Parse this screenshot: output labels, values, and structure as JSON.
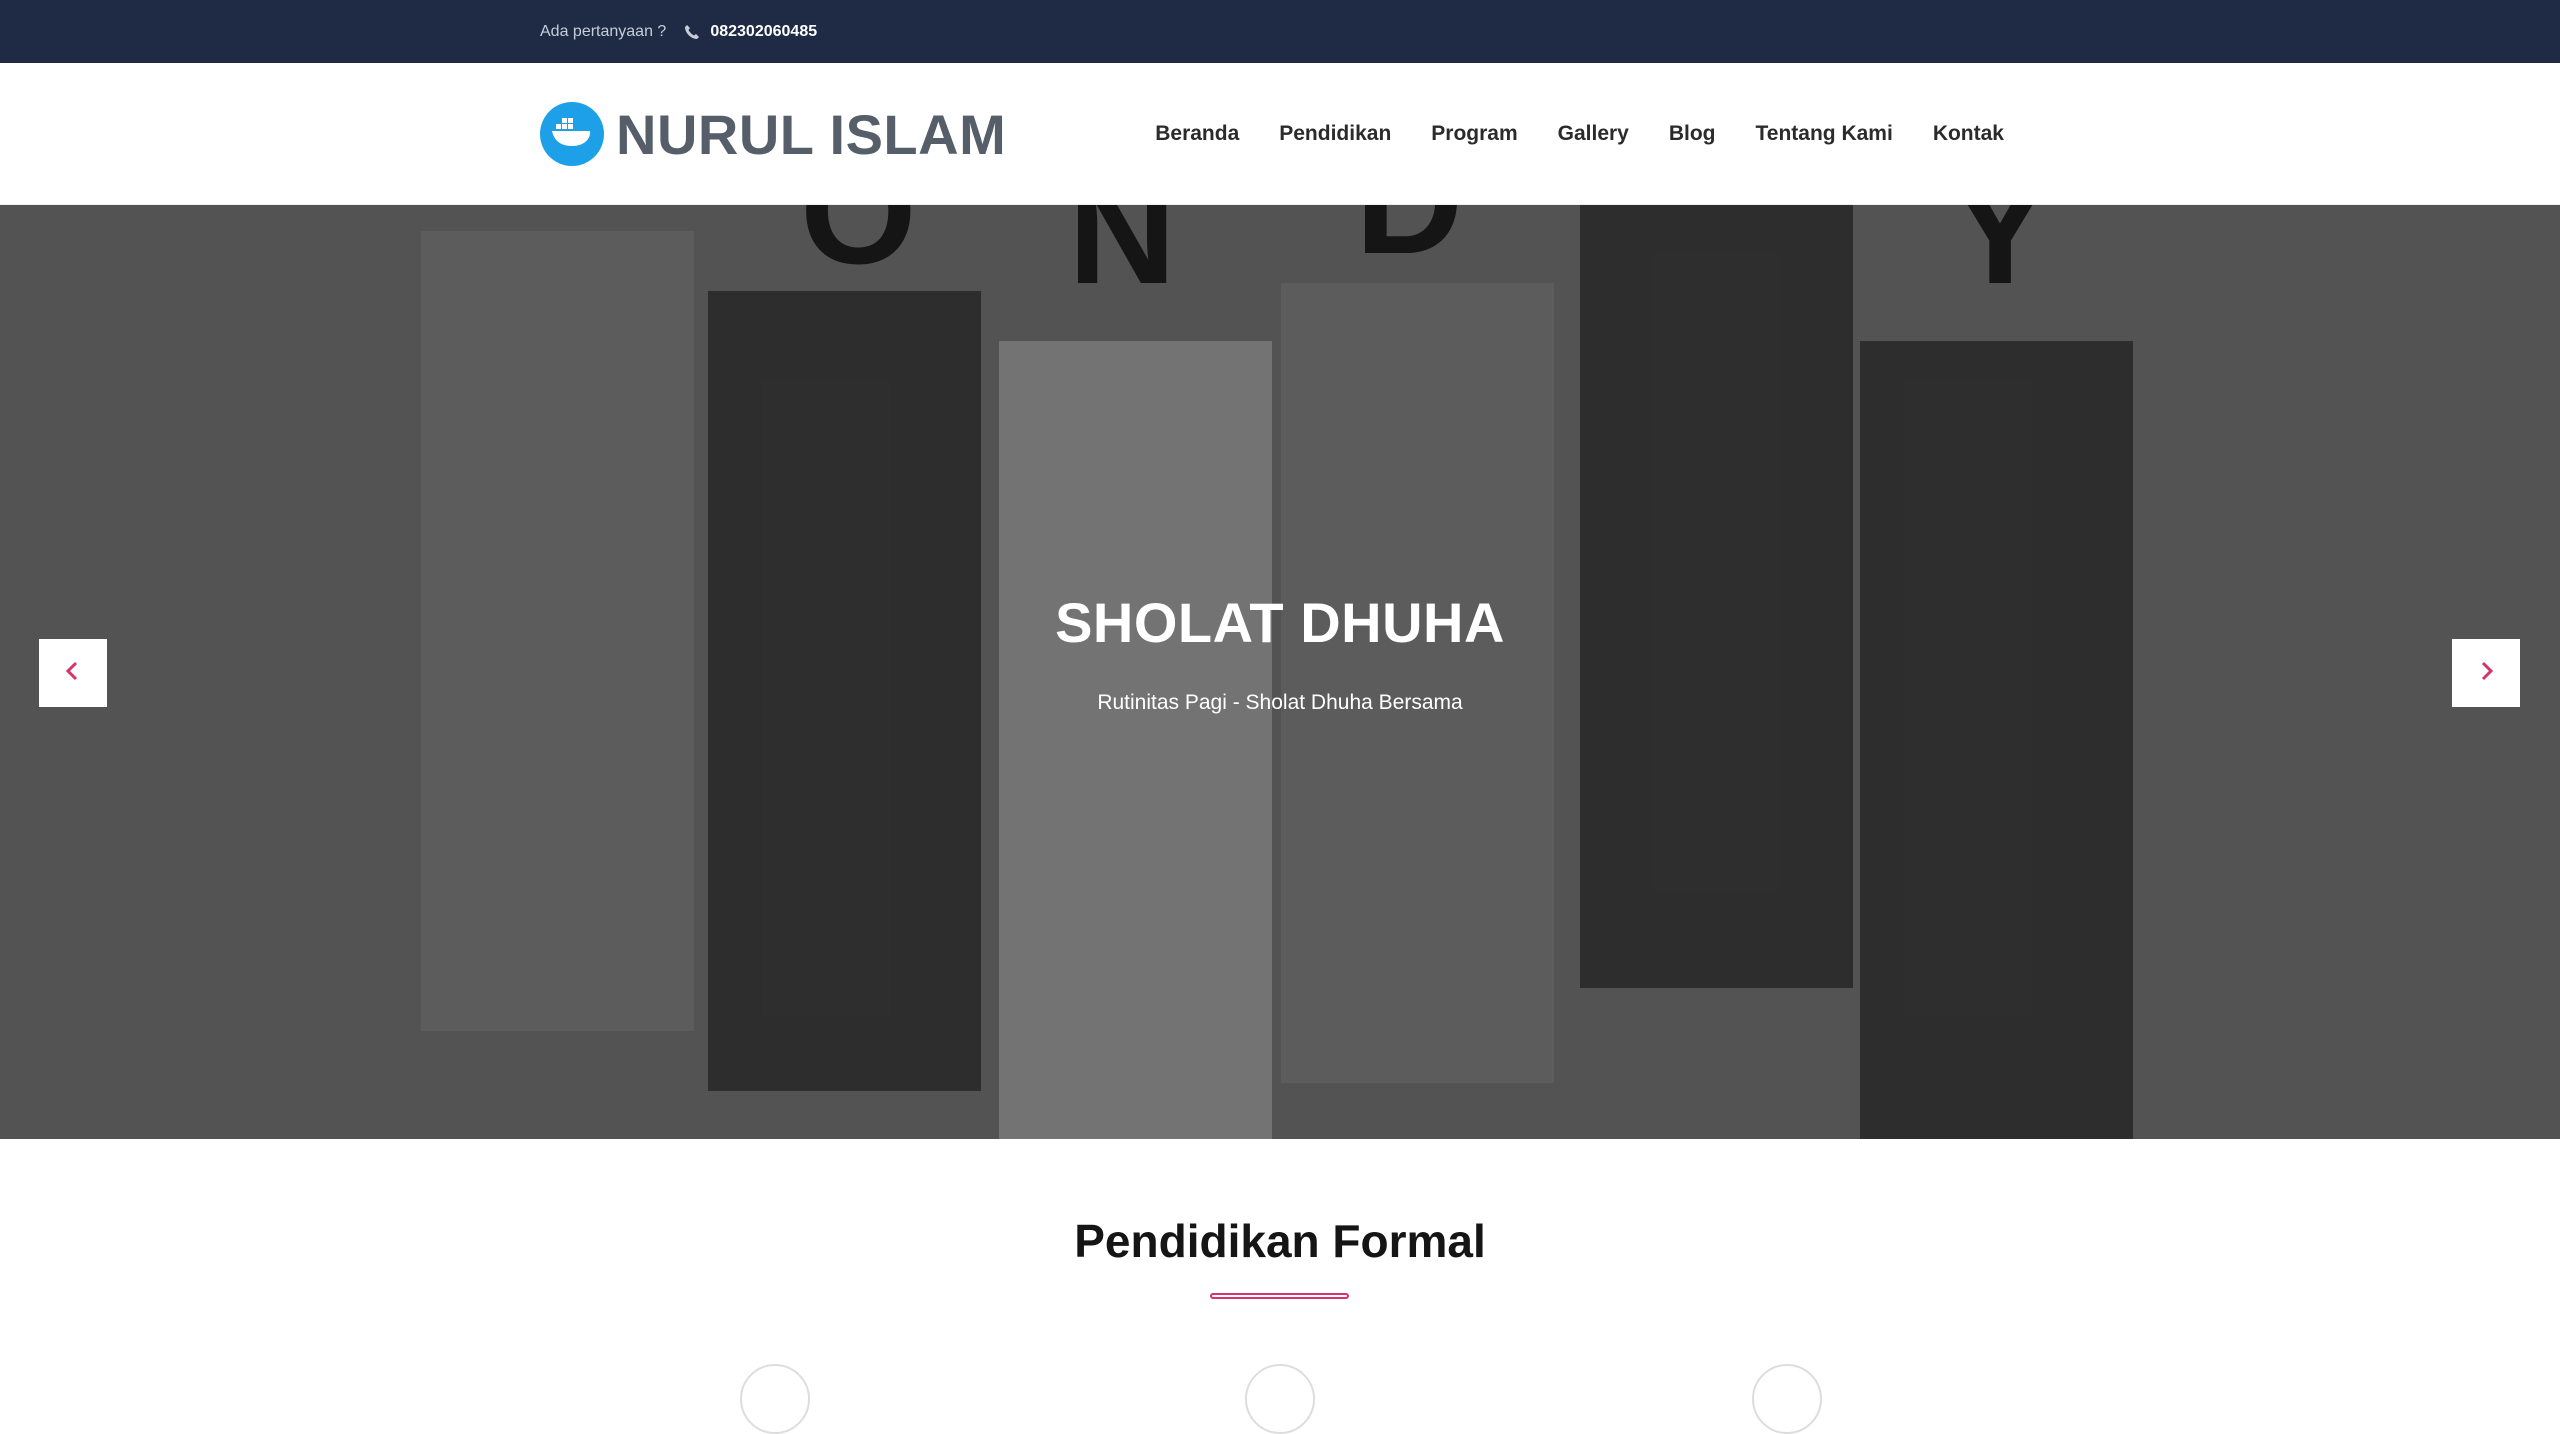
{
  "topbar": {
    "question_label": "Ada pertanyaan ?",
    "phone": "082302060485",
    "icons": {
      "phone": "phone-icon"
    }
  },
  "header": {
    "brand_name": "NURUL ISLAM",
    "logo_icon": "ship-container-logo-icon",
    "nav": [
      "Beranda",
      "Pendidikan",
      "Program",
      "Gallery",
      "Blog",
      "Tentang Kami",
      "Kontak"
    ]
  },
  "hero": {
    "title": "SHOLAT DHUHA",
    "subtitle": "Rutinitas Pagi - Sholat Dhuha Bersama",
    "prev_icon": "chevron-left-icon",
    "next_icon": "chevron-right-icon"
  },
  "section": {
    "title": "Pendidikan Formal"
  },
  "colors": {
    "topbar_bg": "#1f2a45",
    "accent": "#d6336c",
    "logo_blue": "#1ea0e8",
    "brand_text": "#555e69"
  }
}
